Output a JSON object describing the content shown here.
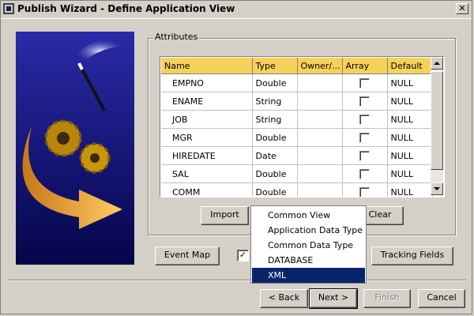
{
  "window": {
    "title": "Publish Wizard - Define Application View",
    "close_glyph": "✕"
  },
  "group": {
    "label": "Attributes"
  },
  "table": {
    "columns": [
      "Name",
      "Type",
      "Owner/...",
      "Array",
      "Default"
    ],
    "rows": [
      {
        "name": "EMPNO",
        "type": "Double",
        "owner": "",
        "array": false,
        "default": "NULL"
      },
      {
        "name": "ENAME",
        "type": "String",
        "owner": "",
        "array": false,
        "default": "NULL"
      },
      {
        "name": "JOB",
        "type": "String",
        "owner": "",
        "array": false,
        "default": "NULL"
      },
      {
        "name": "MGR",
        "type": "Double",
        "owner": "",
        "array": false,
        "default": "NULL"
      },
      {
        "name": "HIREDATE",
        "type": "Date",
        "owner": "",
        "array": false,
        "default": "NULL"
      },
      {
        "name": "SAL",
        "type": "Double",
        "owner": "",
        "array": false,
        "default": "NULL"
      },
      {
        "name": "COMM",
        "type": "Double",
        "owner": "",
        "array": false,
        "default": "NULL"
      }
    ]
  },
  "buttons": {
    "import": "Import",
    "clear": "Clear",
    "event_map": "Event Map",
    "tracking_fields": "Tracking Fields",
    "back": "< Back",
    "next": "Next >",
    "finish": "Finish",
    "cancel": "Cancel"
  },
  "checkbox": {
    "checked": true,
    "glyph": "✓"
  },
  "menu": {
    "items": [
      "Common View",
      "Application Data Type",
      "Common Data Type",
      "DATABASE",
      "XML"
    ],
    "selected": "XML"
  },
  "colors": {
    "header": "#f7d25a",
    "selection": "#0a246a",
    "face": "#d4d0c8"
  }
}
